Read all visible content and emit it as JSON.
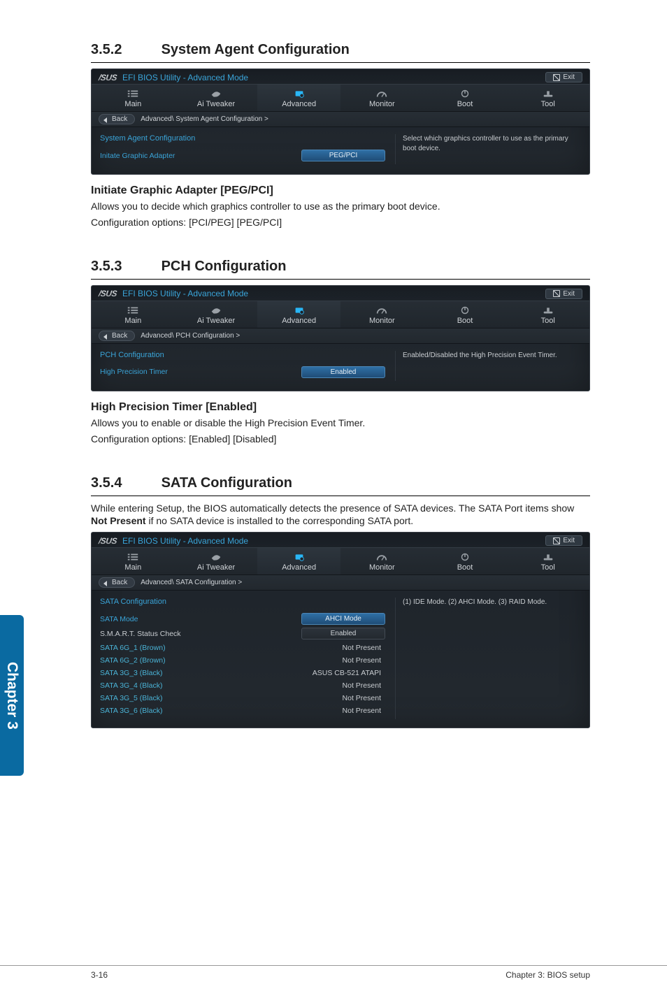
{
  "side_tab": "Chapter 3",
  "footer": {
    "left": "3-16",
    "right": "Chapter 3: BIOS setup"
  },
  "s352": {
    "num": "3.5.2",
    "title": "System Agent Configuration",
    "bios": {
      "logo": "/SUS",
      "title": "EFI BIOS Utility - Advanced Mode",
      "exit": "Exit",
      "tabs": [
        "Main",
        "Ai Tweaker",
        "Advanced",
        "Monitor",
        "Boot",
        "Tool"
      ],
      "back": "Back",
      "breadcrumb": "Advanced\\ System Agent Configuration  >",
      "cfg_title": "System Agent Configuration",
      "row_label": "Initate Graphic Adapter",
      "row_value": "PEG/PCI",
      "help": "Select which graphics controller to use as the primary boot device."
    },
    "sub_heading": "Initiate Graphic Adapter [PEG/PCI]",
    "para1": "Allows you to decide which graphics controller to use as the primary boot device.",
    "para2": "Configuration options: [PCI/PEG] [PEG/PCI]"
  },
  "s353": {
    "num": "3.5.3",
    "title": "PCH Configuration",
    "bios": {
      "logo": "/SUS",
      "title": "EFI BIOS Utility - Advanced Mode",
      "exit": "Exit",
      "tabs": [
        "Main",
        "Ai  Tweaker",
        "Advanced",
        "Monitor",
        "Boot",
        "Tool"
      ],
      "back": "Back",
      "breadcrumb": "Advanced\\ PCH Configuration  >",
      "cfg_title": "PCH Configuration",
      "row_label": "High Precision Timer",
      "row_value": "Enabled",
      "help": "Enabled/Disabled the High Precision Event Timer."
    },
    "sub_heading": "High Precision Timer [Enabled]",
    "para1": "Allows you to enable or disable the High Precision Event Timer.",
    "para2": "Configuration options: [Enabled] [Disabled]"
  },
  "s354": {
    "num": "3.5.4",
    "title": "SATA Configuration",
    "intro1": "While entering Setup, the BIOS automatically detects the presence of SATA devices. The SATA Port items show ",
    "intro_bold": "Not Present",
    "intro2": " if no SATA device is installed to the corresponding SATA port.",
    "bios": {
      "logo": "/SUS",
      "title": "EFI BIOS Utility - Advanced Mode",
      "exit": "Exit",
      "tabs": [
        "Main",
        "Ai Tweaker",
        "Advanced",
        "Monitor",
        "Boot",
        "Tool"
      ],
      "back": "Back",
      "breadcrumb": "Advanced\\ SATA Configuration  >",
      "cfg_title": "SATA Configuration",
      "help": "(1) IDE Mode. (2) AHCI Mode. (3) RAID Mode.",
      "mode_label": "SATA Mode",
      "mode_value": "AHCI Mode",
      "smart_label": "S.M.A.R.T. Status Check",
      "smart_value": "Enabled",
      "ports": [
        {
          "name": "SATA 6G_1 (Brown)",
          "status": "Not Present"
        },
        {
          "name": "SATA 6G_2 (Brown)",
          "status": "Not Present"
        },
        {
          "name": "SATA 3G_3 (Black)",
          "status": "ASUS   CB-521 ATAPI"
        },
        {
          "name": "SATA 3G_4 (Black)",
          "status": "Not Present"
        },
        {
          "name": "SATA 3G_5 (Black)",
          "status": "Not Present"
        },
        {
          "name": "SATA 3G_6 (Black)",
          "status": "Not Present"
        }
      ]
    }
  }
}
